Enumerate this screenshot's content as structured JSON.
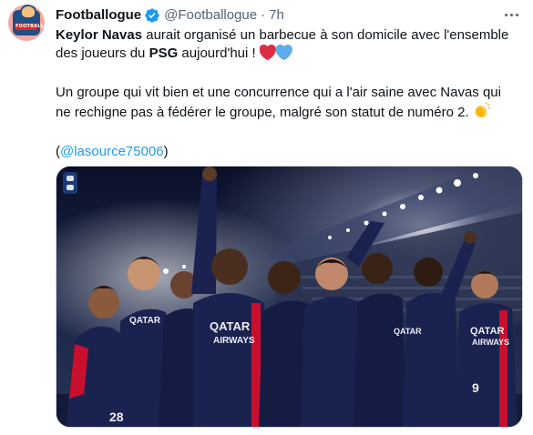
{
  "tweet": {
    "author": {
      "display_name": "Footballogue",
      "handle": "@Footballogue",
      "separator": "·",
      "time": "7h",
      "verified": true,
      "avatar_icon": "footballogue-logo",
      "avatar_banner_text": "FOOTBALLOGUE"
    },
    "body": {
      "line1_bold": "Keylor Navas",
      "line1_rest": " aurait organisé un barbecue à son domicile avec l'ensemble",
      "line2_start": "des joueurs du ",
      "line2_bold": "PSG",
      "line2_rest": " aujourd'hui ! ",
      "line2_emoji": [
        "red-heart",
        "blue-heart"
      ],
      "line3": "Un groupe qui vit bien et une concurrence qui a l'air saine avec Navas qui",
      "line4": "ne rechigne pas à fédérer le groupe, malgré son statut de numéro 2. ",
      "line4_emoji": "clapping-hands",
      "source_open": "(",
      "source_mention": "@lasource75006",
      "source_close": ")"
    },
    "media": {
      "type": "photo",
      "jersey_text": "QATAR AIRWAYS",
      "colors": {
        "jersey": "#1a2350",
        "jersey_stripe": "#c8102e",
        "sky": "#0e1430",
        "lights": "#f3f6ff",
        "crowd": "#2c3450"
      }
    },
    "colors": {
      "accent": "#1d9bf0",
      "secondary_text": "#536471",
      "border": "#cfd9de"
    }
  }
}
